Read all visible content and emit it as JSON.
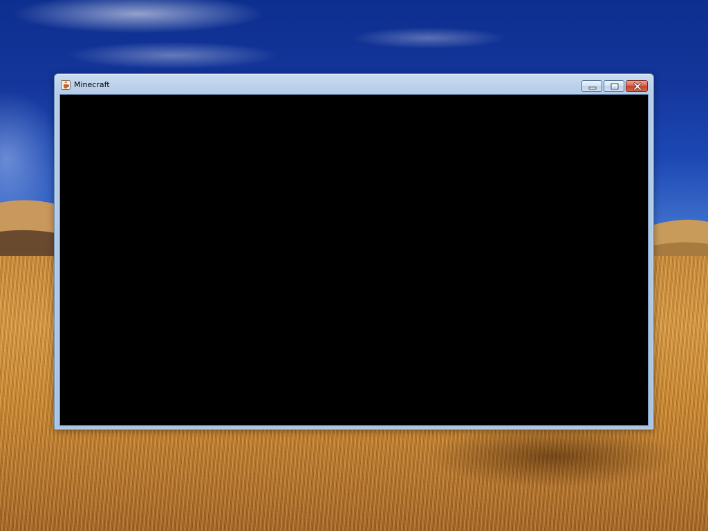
{
  "desktop": {
    "wallpaper": "wheat-field-blue-sky"
  },
  "window": {
    "title": "Minecraft",
    "app_icon": "java-cup-icon",
    "controls": {
      "minimize": "minimize-icon",
      "maximize": "maximize-icon",
      "close": "close-icon"
    },
    "client_color": "#000000"
  },
  "colors": {
    "frame": "#a9c4e4",
    "close_button": "#c3402a",
    "sky": "#14359a",
    "field": "#c98a3a"
  }
}
